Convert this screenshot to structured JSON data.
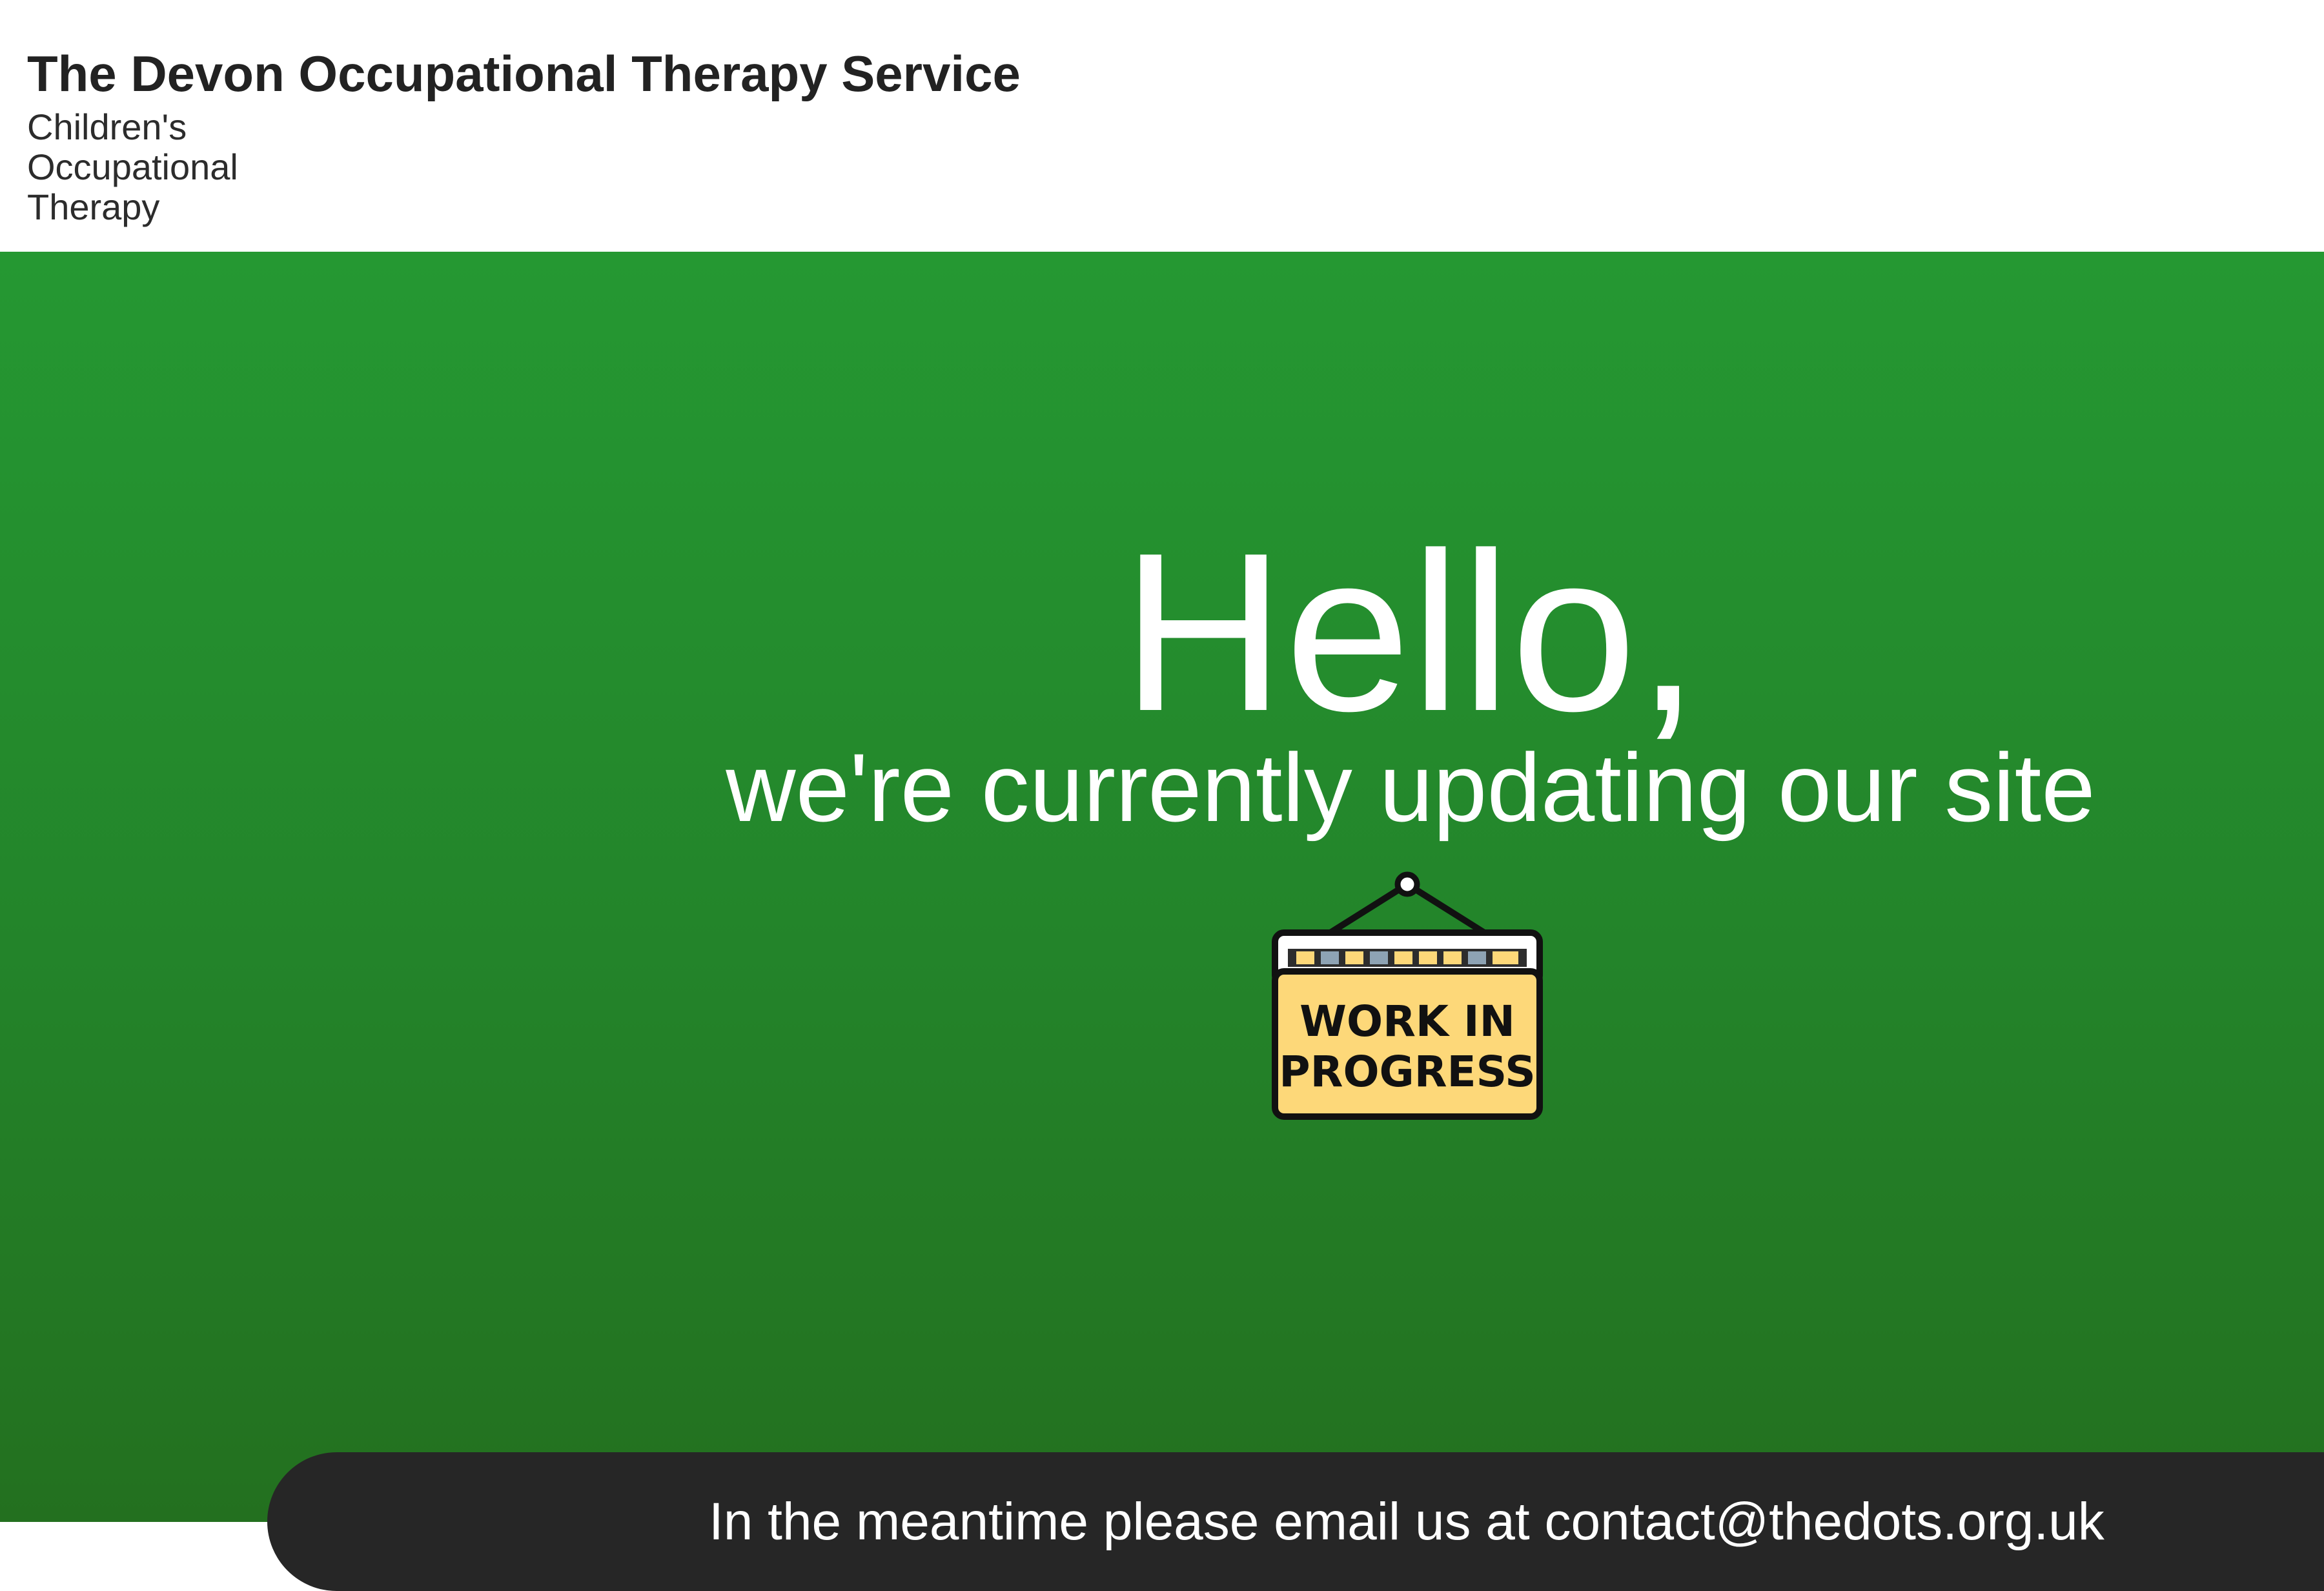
{
  "header": {
    "title": "The Devon Occupational Therapy Service",
    "subtitle": "Children's Occupational Therapy"
  },
  "hero": {
    "heading": "Hello,",
    "subheading": "we're currently updating our site",
    "sign": {
      "icon": "work-in-progress-sign-icon",
      "line1": "WORK IN",
      "line2": "PROGRESS"
    },
    "colors": {
      "background_top": "#259832",
      "background_bottom": "#23701f",
      "text": "#ffffff"
    }
  },
  "contact_bar": {
    "text": "In the meantime please email us at contact@thedots.org.uk",
    "background_color": "#262626"
  }
}
